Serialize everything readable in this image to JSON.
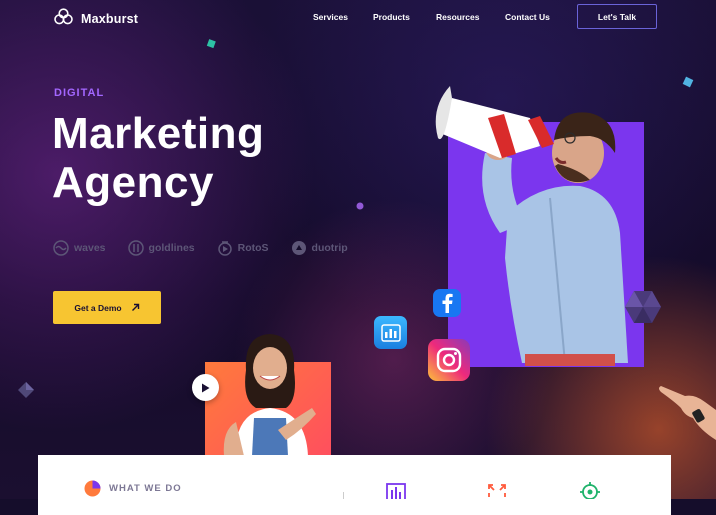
{
  "brand": {
    "name": "Maxburst"
  },
  "nav": {
    "links": [
      "Services",
      "Products",
      "Resources",
      "Contact Us"
    ],
    "cta": "Let's Talk"
  },
  "hero": {
    "eyebrow": "DIGITAL",
    "title_line1": "Marketing",
    "title_line2": "Agency",
    "partners": [
      "waves",
      "goldlines",
      "RotoS",
      "duotrip"
    ],
    "demo_button": "Get a Demo"
  },
  "services_panel": {
    "label": "WHAT WE DO"
  },
  "icons": {
    "logo": "triple-circle-logo-icon",
    "demo_arrow": "arrow-up-right-icon",
    "play": "play-icon",
    "social": [
      "facebook-icon",
      "chart-app-icon",
      "instagram-icon"
    ],
    "services": [
      "bar-chart-icon",
      "expand-arrows-icon",
      "target-icon"
    ]
  },
  "colors": {
    "background": "#150d2b",
    "accent_purple": "#7b36ee",
    "eyebrow": "#a367ff",
    "cta_yellow": "#f7c531",
    "nav_border": "#6a63d8",
    "orange": "#ff6a3d"
  }
}
